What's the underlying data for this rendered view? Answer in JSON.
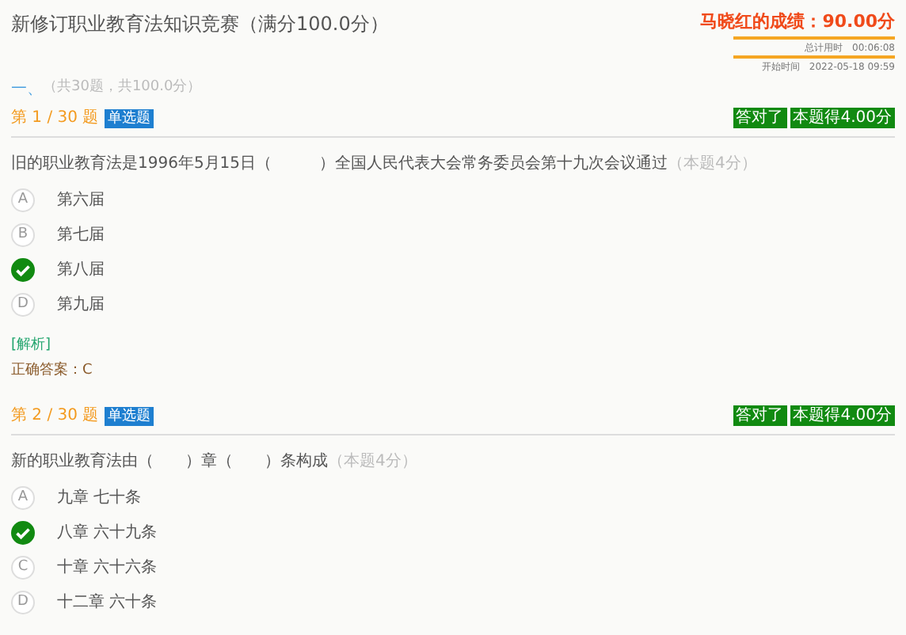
{
  "title": "新修订职业教育法知识竞赛（满分100.0分）",
  "score": {
    "text": "马晓红的成绩：90.00分",
    "time_label": "总计用时",
    "time": "00:06:08",
    "start_label": "开始时间",
    "start": "2022-05-18 09:59"
  },
  "section": {
    "number": "一、",
    "summary": "（共30题，共100.0分）"
  },
  "questions": [
    {
      "counter": "第 1 / 30 题",
      "type": "单选题",
      "result": "答对了",
      "points": "本题得4.00分",
      "text": "旧的职业教育法是1996年5月15日（　　　）全国人民代表大会常务委员会第十九次会议通过",
      "worth": "（本题4分）",
      "options": [
        {
          "letter": "A",
          "text": "第六届",
          "selected": false
        },
        {
          "letter": "B",
          "text": "第七届",
          "selected": false
        },
        {
          "text": "第八届",
          "selected": true
        },
        {
          "letter": "D",
          "text": "第九届",
          "selected": false
        }
      ],
      "analysis": "[解析]",
      "answer": "正确答案：C"
    },
    {
      "counter": "第 2 / 30 题",
      "type": "单选题",
      "result": "答对了",
      "points": "本题得4.00分",
      "text": "新的职业教育法由（　　）章（　　）条构成",
      "worth": "（本题4分）",
      "options": [
        {
          "letter": "A",
          "text": "九章 七十条",
          "selected": false
        },
        {
          "text": "八章 六十九条",
          "selected": true
        },
        {
          "letter": "C",
          "text": "十章 六十六条",
          "selected": false
        },
        {
          "letter": "D",
          "text": "十二章 六十条",
          "selected": false
        }
      ]
    }
  ]
}
